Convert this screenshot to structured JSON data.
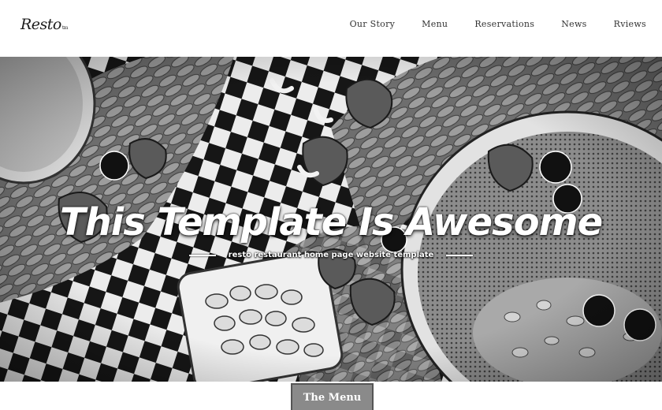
{
  "brand": {
    "name": "Resto",
    "tm": "tm"
  },
  "nav": {
    "items": [
      "Our Story",
      "Menu",
      "Reservations",
      "News",
      "Rviews"
    ]
  },
  "hero": {
    "title": "This Template Is Awesome",
    "subtitle": "resto restaurant home page website template"
  },
  "menu_button": {
    "label": "The Menu"
  },
  "colors": {
    "header_bg": "#ffffff",
    "tab_bg": "#8a8a8a",
    "tab_border": "#555555",
    "hero_text": "#ffffff"
  }
}
